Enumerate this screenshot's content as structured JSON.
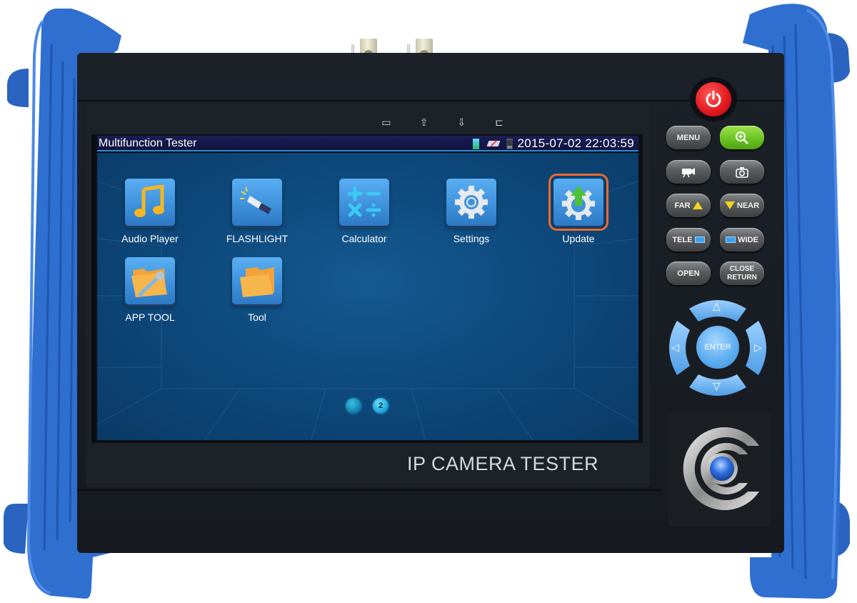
{
  "device": {
    "brand_label": "IP CAMERA TESTER",
    "colors": {
      "bumper": "#2f6fd0",
      "body": "#171b21",
      "accent_select": "#ec6a2f",
      "power": "#e0161c",
      "zoom_key": "#6cc424",
      "dpad": "#5eaef2"
    },
    "hw_indicators": [
      {
        "icon": "battery-charge-icon",
        "glyph": "▭"
      },
      {
        "icon": "upload-arrow-icon",
        "glyph": "⇧"
      },
      {
        "icon": "download-arrow-icon",
        "glyph": "⇩"
      },
      {
        "icon": "power-plug-icon",
        "glyph": "⊏"
      }
    ]
  },
  "statusbar": {
    "title": "Multifunction Tester",
    "icons": [
      "signal-icon",
      "network-disconnected-icon",
      "battery-icon"
    ],
    "datetime": "2015-07-02 22:03:59"
  },
  "apps": [
    {
      "label": "Audio Player",
      "icon": "music-note-icon",
      "selected": false
    },
    {
      "label": "FLASHLIGHT",
      "icon": "flashlight-icon",
      "selected": false
    },
    {
      "label": "Calculator",
      "icon": "calculator-icon",
      "selected": false
    },
    {
      "label": "Settings",
      "icon": "gear-icon",
      "selected": false
    },
    {
      "label": "Update",
      "icon": "update-gear-icon",
      "selected": true
    },
    {
      "label": "APP TOOL",
      "icon": "folder-wrench-icon",
      "selected": false
    },
    {
      "label": "Tool",
      "icon": "folder-icon",
      "selected": false
    }
  ],
  "pager": {
    "pages": [
      "",
      "2"
    ],
    "current_page": 2
  },
  "keypad": {
    "power": {
      "icon": "power-icon"
    },
    "keys": [
      {
        "label": "MENU"
      },
      {
        "label": "",
        "icon": "zoom-in-icon"
      },
      {
        "label": "",
        "icon": "video-camera-icon"
      },
      {
        "label": "",
        "icon": "camera-icon"
      },
      {
        "label": "FAR",
        "icon": "triangle-up-icon"
      },
      {
        "label": "NEAR",
        "icon": "triangle-down-icon"
      },
      {
        "label": "TELE",
        "icon": "zoom-rect-icon"
      },
      {
        "label": "WIDE",
        "icon": "zoom-rect-icon"
      },
      {
        "label": "OPEN"
      },
      {
        "label_line1": "CLOSE",
        "label_line2": "RETURN"
      }
    ],
    "dpad": {
      "enter": "ENTER",
      "up": "△",
      "down": "▽",
      "left": "◁",
      "right": "▷"
    }
  }
}
